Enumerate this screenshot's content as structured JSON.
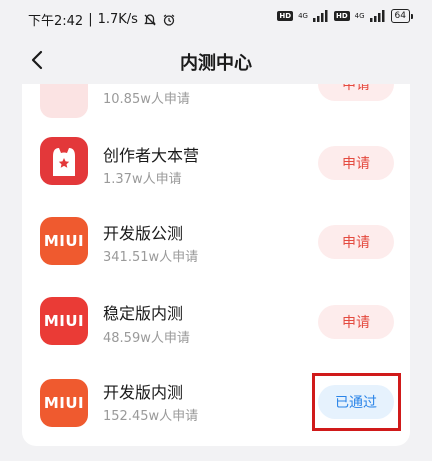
{
  "status_bar": {
    "time": "下午2:42",
    "net_speed": "1.7K/s",
    "signal1_gen": "4G",
    "signal2_gen": "4G",
    "hd": "HD",
    "battery": "64"
  },
  "nav": {
    "title": "内测中心"
  },
  "programs": [
    {
      "name": "",
      "count": "10.85w人申请",
      "action": "申请",
      "icon_text": "",
      "icon_color": "#f8d6d6"
    },
    {
      "name": "创作者大本营",
      "count": "1.37w人申请",
      "action": "申请",
      "icon_text": "",
      "icon_color": "#e3383a"
    },
    {
      "name": "开发版公测",
      "count": "341.51w人申请",
      "action": "申请",
      "icon_text": "MIUI",
      "icon_color": "#ef5a2f"
    },
    {
      "name": "稳定版内测",
      "count": "48.59w人申请",
      "action": "申请",
      "icon_text": "MIUI",
      "icon_color": "#ea3b36"
    },
    {
      "name": "开发版内测",
      "count": "152.45w人申请",
      "action": "已通过",
      "icon_text": "MIUI",
      "icon_color": "#ef5a2f"
    }
  ],
  "colors": {
    "apply_text": "#e44a3f",
    "apply_bg": "#fdecec",
    "passed_text": "#2a84e8",
    "passed_bg": "#e6f2fd",
    "highlight_border": "#d01a1a"
  }
}
